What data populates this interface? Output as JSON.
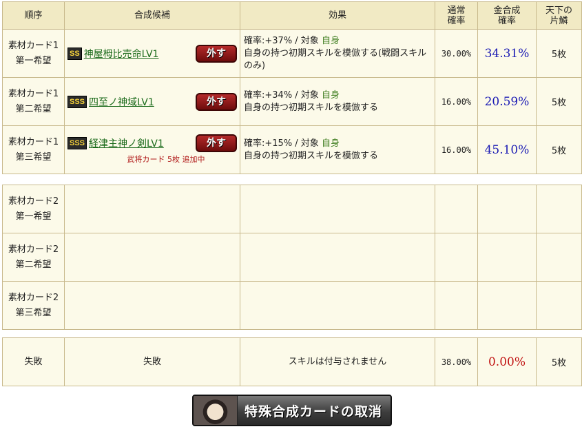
{
  "headers": {
    "order": "順序",
    "candidate": "合成候補",
    "effect": "効果",
    "normal_rate": "通常\n確率",
    "gold_rate": "金合成\n確率",
    "scale": "天下の\n片鱗"
  },
  "group1": [
    {
      "order_line1": "素材カード1",
      "order_line2": "第一希望",
      "rank": "SS",
      "name": "神屋栂比売命LV1",
      "remove_label": "外す",
      "effect_prefix": "確率:+37% / 対象",
      "effect_target": "自身",
      "effect_desc": "自身の持つ初期スキルを模倣する(戦闘スキルのみ)",
      "normal_rate": "30.00%",
      "gold_rate": "34.31%",
      "scale": "5枚",
      "note": ""
    },
    {
      "order_line1": "素材カード1",
      "order_line2": "第二希望",
      "rank": "SSS",
      "name": "四至ノ神域LV1",
      "remove_label": "外す",
      "effect_prefix": "確率:+34% / 対象",
      "effect_target": "自身",
      "effect_desc": "自身の持つ初期スキルを模倣する",
      "normal_rate": "16.00%",
      "gold_rate": "20.59%",
      "scale": "5枚",
      "note": ""
    },
    {
      "order_line1": "素材カード1",
      "order_line2": "第三希望",
      "rank": "SSS",
      "name": "経津主神ノ剣LV1",
      "remove_label": "外す",
      "effect_prefix": "確率:+15% / 対象",
      "effect_target": "自身",
      "effect_desc": "自身の持つ初期スキルを模倣する",
      "normal_rate": "16.00%",
      "gold_rate": "45.10%",
      "scale": "5枚",
      "note": "武将カード 5枚 追加中"
    }
  ],
  "group2": [
    {
      "order_line1": "素材カード2",
      "order_line2": "第一希望"
    },
    {
      "order_line1": "素材カード2",
      "order_line2": "第二希望"
    },
    {
      "order_line1": "素材カード2",
      "order_line2": "第三希望"
    }
  ],
  "failure": {
    "order": "失敗",
    "candidate": "失敗",
    "effect": "スキルは付与されません",
    "normal_rate": "38.00%",
    "gold_rate": "0.00%",
    "scale": "5枚"
  },
  "cancel_button": {
    "label": "特殊合成カードの取消",
    "icon": "character-portrait-icon"
  },
  "colors": {
    "header_bg": "#f1eac4",
    "cell_bg": "#fcfae9",
    "border": "#c8b98c",
    "gold_rate": "#1a1ab4",
    "fail_rate": "#c01010",
    "candidate_link": "#1a6a1a",
    "target": "#3e7d1f",
    "note": "#b01818"
  }
}
